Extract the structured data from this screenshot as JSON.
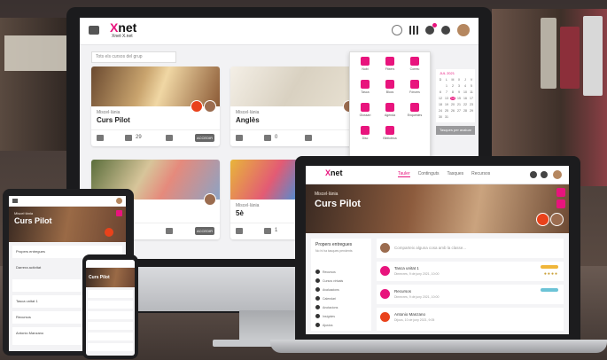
{
  "app": {
    "logo": "Xnet",
    "logo_sub": "Xnet·X.net"
  },
  "imac": {
    "filter_placeholder": "Tots els cursos del grup",
    "cards": [
      {
        "meta": "Miscel·lània",
        "title": "Curs Pilot",
        "count": "29",
        "btn": "ACCEDIR"
      },
      {
        "meta": "Miscel·lània",
        "title": "Anglès",
        "count": "0",
        "btn": "ACCEDIR"
      },
      {
        "meta": "",
        "title": "",
        "count": "",
        "btn": "ACCEDIR"
      },
      {
        "meta": "Miscel·lània",
        "title": "5è",
        "count": "1",
        "btn": "ACCEDIR"
      }
    ],
    "apps": [
      "Nubi",
      "Fitxers",
      "Correu",
      "Tasca",
      "Blocs",
      "Fòrums",
      "Glossari",
      "Agenda",
      "Enquestes",
      "Disc",
      "Biblioteca",
      "Notes"
    ],
    "calendar": {
      "title": "JUL 2021",
      "days": [
        "D",
        "L",
        "M",
        "X",
        "J",
        "V",
        "",
        "1",
        "2",
        "3",
        "4",
        "5",
        "6",
        "7",
        "8",
        "9",
        "10",
        "11",
        "12",
        "13",
        "14",
        "15",
        "16",
        "17",
        "18",
        "19",
        "20",
        "21",
        "22",
        "23",
        "24",
        "25",
        "26",
        "27",
        "28",
        "29",
        "30",
        "31"
      ]
    },
    "pending_btn": "Tasques per avaluar"
  },
  "laptop": {
    "logo": "Xnet",
    "logo_sub": "Xnet·X.net",
    "tabs": [
      "Tauler",
      "Continguts",
      "Tasques",
      "Recursos"
    ],
    "hero_meta": "Miscel·lània",
    "hero_title": "Curs Pilot",
    "side_head": "Propers entregues",
    "side_sub": "No hi ha tasques pendents",
    "side_items": [
      "Recursos",
      "Cursos virtuals",
      "Avaluacions",
      "Calendari",
      "Anotacions",
      "Insígnies",
      "Ajustos"
    ],
    "compose": "Comparteix alguna cosa amb la classe...",
    "posts": [
      {
        "t1": "Tasca unitat 1",
        "t2": "Dimecres, 9 de juny 2021, 10:00"
      },
      {
        "t1": "Recursos",
        "t2": "Dimecres, 9 de juny 2021, 10:00"
      },
      {
        "t1": "Antonio Manzano",
        "t2": "Dijous, 10 de juny 2021, 9:05"
      }
    ]
  },
  "tablet": {
    "hero_meta": "Miscel·lània",
    "hero_title": "Curs Pilot",
    "rows": [
      "Propers entregues",
      "Tasca unitat 1",
      "Recursos",
      "Antonio Manzano"
    ],
    "select": "Darrera activitat"
  },
  "phone": {
    "hero_title": "Curs Pilot"
  },
  "colors": {
    "accent": "#e8147d"
  }
}
